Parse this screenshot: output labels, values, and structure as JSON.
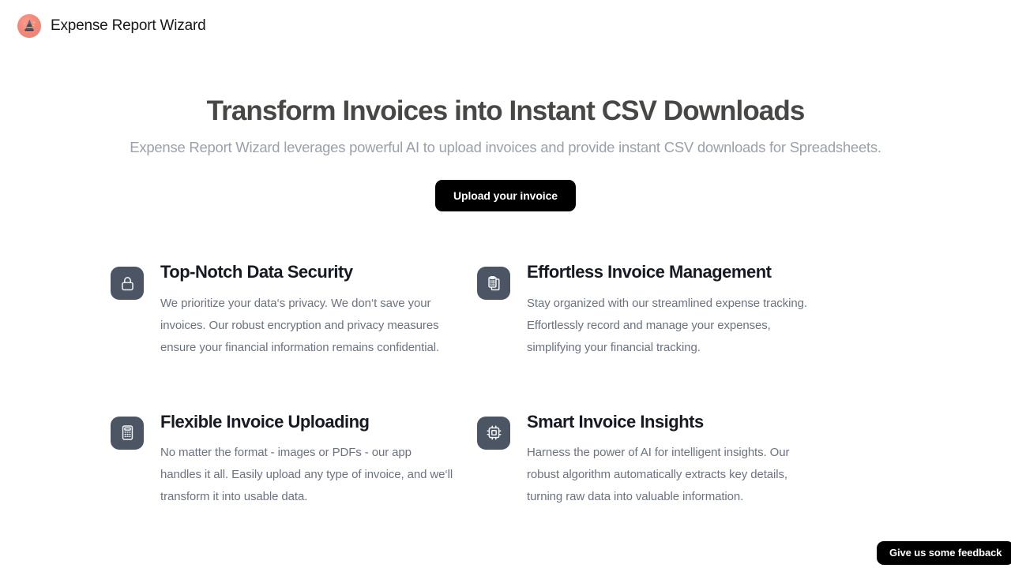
{
  "header": {
    "brand_name": "Expense Report Wizard",
    "logo_icon": "wizard-hat-icon",
    "logo_bg_color": "#f2897a"
  },
  "hero": {
    "title": "Transform Invoices into Instant CSV Downloads",
    "subtitle": "Expense Report Wizard leverages powerful AI to upload invoices and provide instant CSV downloads for Spreadsheets.",
    "cta_label": "Upload your invoice",
    "cta_bg_color": "#000000",
    "title_color": "#484745",
    "subtitle_color": "#9aa1ab"
  },
  "features": {
    "icon_bg_color": "#4b5563",
    "items": [
      {
        "icon": "lock-icon",
        "title": "Top-Notch Data Security",
        "description": "We prioritize your data‘s privacy. We don‘t save your invoices. Our robust encryption and privacy measures ensure your financial information remains confidential."
      },
      {
        "icon": "clipboard-copy-icon",
        "title": "Effortless Invoice Management",
        "description": "Stay organized with our streamlined expense tracking. Effortlessly record and manage your expenses, simplifying your financial tracking."
      },
      {
        "icon": "calculator-icon",
        "title": "Flexible Invoice Uploading",
        "description": "No matter the format - images or PDFs - our app handles it all. Easily upload any type of invoice, and we‘ll transform it into usable data."
      },
      {
        "icon": "cpu-chip-icon",
        "title": "Smart Invoice Insights",
        "description": "Harness the power of AI for intelligent insights. Our robust algorithm automatically extracts key details, turning raw data into valuable information."
      }
    ]
  },
  "feedback": {
    "label": "Give us some feedback"
  }
}
